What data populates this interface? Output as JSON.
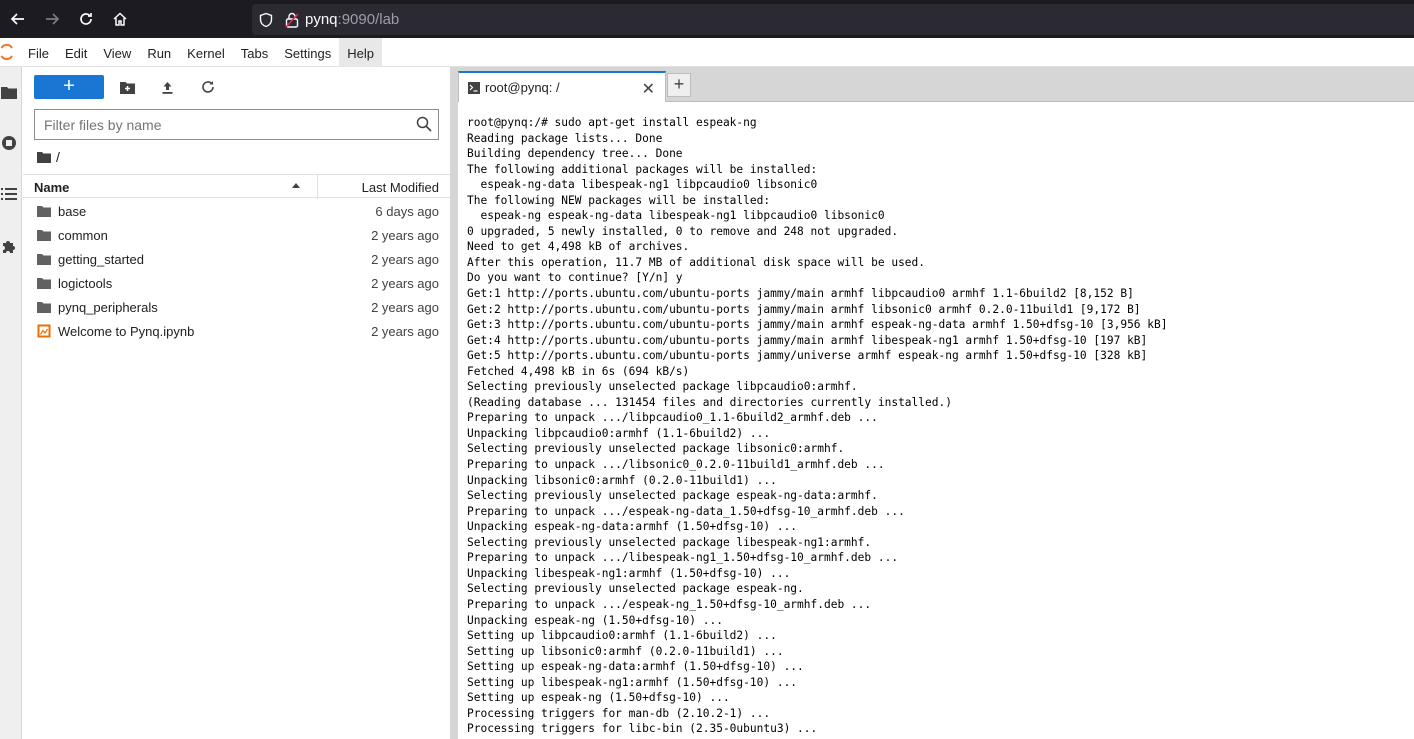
{
  "browser": {
    "url_host": "pynq",
    "url_rest": ":9090/lab"
  },
  "menu": [
    "File",
    "Edit",
    "View",
    "Run",
    "Kernel",
    "Tabs",
    "Settings",
    "Help"
  ],
  "filebrowser": {
    "new_label": "+",
    "search_placeholder": "Filter files by name",
    "breadcrumb": "/",
    "col_name": "Name",
    "col_modified": "Last Modified",
    "files": [
      {
        "name": "base",
        "type": "folder",
        "modified": "6 days ago"
      },
      {
        "name": "common",
        "type": "folder",
        "modified": "2 years ago"
      },
      {
        "name": "getting_started",
        "type": "folder",
        "modified": "2 years ago"
      },
      {
        "name": "logictools",
        "type": "folder",
        "modified": "2 years ago"
      },
      {
        "name": "pynq_peripherals",
        "type": "folder",
        "modified": "2 years ago"
      },
      {
        "name": "Welcome to Pynq.ipynb",
        "type": "notebook",
        "modified": "2 years ago"
      }
    ]
  },
  "tabs": {
    "terminal_title": "root@pynq: /",
    "add_label": "+",
    "close_label": "✕"
  },
  "terminal_lines": [
    "root@pynq:/# sudo apt-get install espeak-ng",
    "Reading package lists... Done",
    "Building dependency tree... Done",
    "The following additional packages will be installed:",
    "  espeak-ng-data libespeak-ng1 libpcaudio0 libsonic0",
    "The following NEW packages will be installed:",
    "  espeak-ng espeak-ng-data libespeak-ng1 libpcaudio0 libsonic0",
    "0 upgraded, 5 newly installed, 0 to remove and 248 not upgraded.",
    "Need to get 4,498 kB of archives.",
    "After this operation, 11.7 MB of additional disk space will be used.",
    "Do you want to continue? [Y/n] y",
    "Get:1 http://ports.ubuntu.com/ubuntu-ports jammy/main armhf libpcaudio0 armhf 1.1-6build2 [8,152 B]",
    "Get:2 http://ports.ubuntu.com/ubuntu-ports jammy/main armhf libsonic0 armhf 0.2.0-11build1 [9,172 B]",
    "Get:3 http://ports.ubuntu.com/ubuntu-ports jammy/main armhf espeak-ng-data armhf 1.50+dfsg-10 [3,956 kB]",
    "Get:4 http://ports.ubuntu.com/ubuntu-ports jammy/main armhf libespeak-ng1 armhf 1.50+dfsg-10 [197 kB]",
    "Get:5 http://ports.ubuntu.com/ubuntu-ports jammy/universe armhf espeak-ng armhf 1.50+dfsg-10 [328 kB]",
    "Fetched 4,498 kB in 6s (694 kB/s)",
    "Selecting previously unselected package libpcaudio0:armhf.",
    "(Reading database ... 131454 files and directories currently installed.)",
    "Preparing to unpack .../libpcaudio0_1.1-6build2_armhf.deb ...",
    "Unpacking libpcaudio0:armhf (1.1-6build2) ...",
    "Selecting previously unselected package libsonic0:armhf.",
    "Preparing to unpack .../libsonic0_0.2.0-11build1_armhf.deb ...",
    "Unpacking libsonic0:armhf (0.2.0-11build1) ...",
    "Selecting previously unselected package espeak-ng-data:armhf.",
    "Preparing to unpack .../espeak-ng-data_1.50+dfsg-10_armhf.deb ...",
    "Unpacking espeak-ng-data:armhf (1.50+dfsg-10) ...",
    "Selecting previously unselected package libespeak-ng1:armhf.",
    "Preparing to unpack .../libespeak-ng1_1.50+dfsg-10_armhf.deb ...",
    "Unpacking libespeak-ng1:armhf (1.50+dfsg-10) ...",
    "Selecting previously unselected package espeak-ng.",
    "Preparing to unpack .../espeak-ng_1.50+dfsg-10_armhf.deb ...",
    "Unpacking espeak-ng (1.50+dfsg-10) ...",
    "Setting up libpcaudio0:armhf (1.1-6build2) ...",
    "Setting up libsonic0:armhf (0.2.0-11build1) ...",
    "Setting up espeak-ng-data:armhf (1.50+dfsg-10) ...",
    "Setting up libespeak-ng1:armhf (1.50+dfsg-10) ...",
    "Setting up espeak-ng (1.50+dfsg-10) ...",
    "Processing triggers for man-db (2.10.2-1) ...",
    "Processing triggers for libc-bin (2.35-0ubuntu3) ..."
  ],
  "colors": {
    "accent": "#1976d2",
    "browser_bg": "#1c1b22",
    "notebook_icon": "#ef6c00"
  }
}
